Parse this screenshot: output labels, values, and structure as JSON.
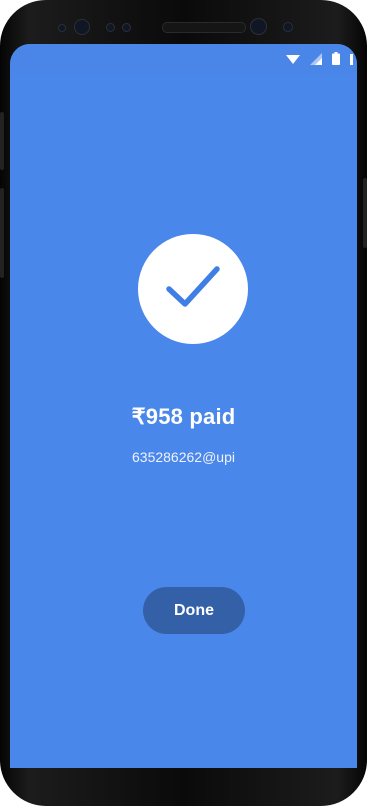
{
  "payment": {
    "amount_text": "₹958 paid",
    "upi_id": "635286262@upi"
  },
  "actions": {
    "done_label": "Done"
  },
  "colors": {
    "screen_background": "#4a87ea",
    "done_button": "#3460a8",
    "check_circle": "#ffffff",
    "check_mark": "#3f7ee6"
  },
  "icons": {
    "status": [
      "wifi-icon",
      "signal-icon",
      "battery-icon"
    ],
    "main": "checkmark-icon"
  }
}
